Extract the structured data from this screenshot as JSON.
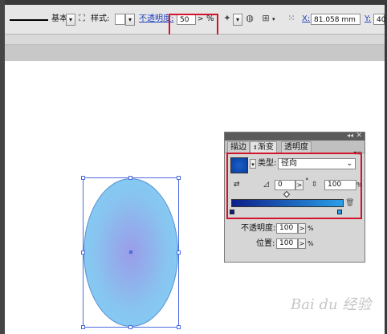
{
  "toolbar": {
    "stroke_profile": "基本",
    "style_label": "样式:",
    "opacity_label": "不透明度:",
    "opacity_value": "50",
    "opacity_unit": "%",
    "x_label": "X:",
    "x_value": "81.058 mm",
    "y_label": "Y:",
    "y_value": "40"
  },
  "gradient_panel": {
    "tabs": [
      "描边",
      "渐变",
      "透明度"
    ],
    "type_label": "类型:",
    "type_value": "径向",
    "angle_value": "0",
    "angle_unit": "°",
    "aspect_value": "100",
    "aspect_unit": "%",
    "stop_opacity_label": "不透明度:",
    "stop_opacity_value": "100",
    "stop_opacity_unit": "%",
    "location_label": "位置:",
    "location_value": "100",
    "location_unit": "%",
    "colors": {
      "gradient_start": "#0d1f8a",
      "gradient_end": "#2a9fe8",
      "swatch": "#1a5fc8",
      "highlight": "#d2142c"
    }
  },
  "canvas": {
    "object": "ellipse",
    "fill_center": "#9a9ce8",
    "fill_edge": "#7fd4f6"
  },
  "watermark": "Bai du 经验"
}
